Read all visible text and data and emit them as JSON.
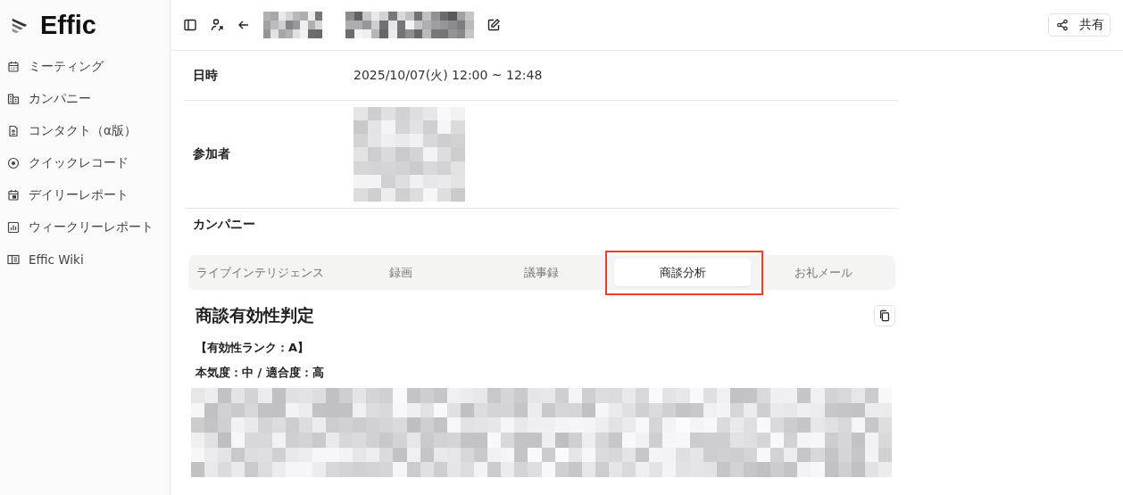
{
  "logo": {
    "text": "Effic"
  },
  "sidebar": {
    "items": [
      {
        "label": "ミーティング",
        "kind": "calendar"
      },
      {
        "label": "カンパニー",
        "kind": "building"
      },
      {
        "label": "コンタクト（α版）",
        "kind": "contact"
      },
      {
        "label": "クイックレコード",
        "kind": "record"
      },
      {
        "label": "デイリーレポート",
        "kind": "daily"
      },
      {
        "label": "ウィークリーレポート",
        "kind": "chart"
      },
      {
        "label": "Effic Wiki",
        "kind": "book"
      }
    ]
  },
  "header": {
    "share_button": "共有"
  },
  "details": [
    {
      "label": "日時",
      "kind": "text",
      "value": "2025/10/07(火) 12:00 ~ 12:48"
    },
    {
      "label": "参加者",
      "kind": "redacted"
    },
    {
      "label": "カンパニー",
      "kind": "empty"
    }
  ],
  "tabs": [
    {
      "label": "ライブインテリジェンス",
      "selected": false,
      "highlighted": false
    },
    {
      "label": "録画",
      "selected": false,
      "highlighted": false
    },
    {
      "label": "議事録",
      "selected": false,
      "highlighted": false
    },
    {
      "label": "商談分析",
      "selected": true,
      "highlighted": true
    },
    {
      "label": "お礼メール",
      "selected": false,
      "highlighted": false
    }
  ],
  "analysis": {
    "title": "商談有効性判定",
    "lines": [
      "【有効性ランク：A】",
      "本気度：中 / 適合度：高"
    ]
  }
}
